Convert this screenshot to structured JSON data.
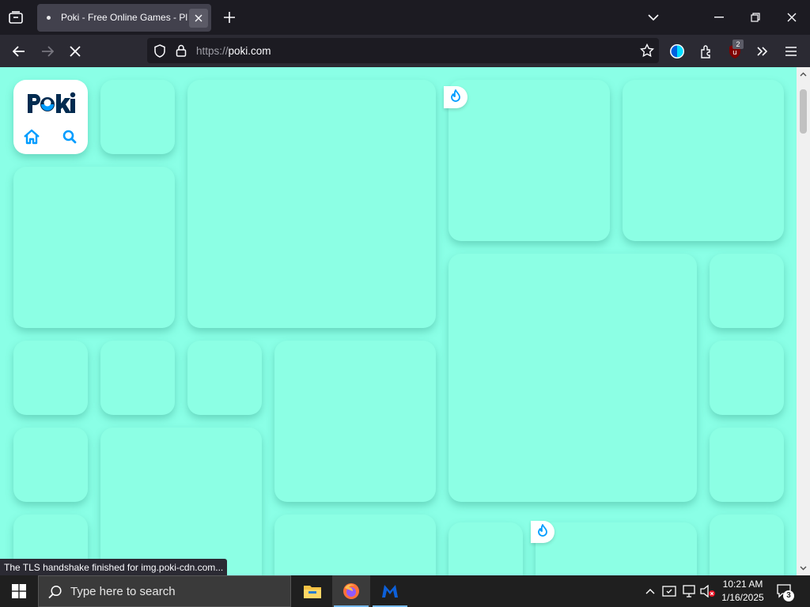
{
  "browser": {
    "tab": {
      "title": "Poki - Free Online Games - Play"
    },
    "url": {
      "scheme": "https://",
      "host": "poki.com"
    },
    "extensions_badge": "2",
    "status_text": "The TLS handshake finished for img.poki-cdn.com..."
  },
  "page": {
    "logo_text": "POKI",
    "icons": [
      "home-icon",
      "search-icon"
    ],
    "accent_color": "#009cff",
    "background_color": "#8affe6"
  },
  "taskbar": {
    "search_placeholder": "Type here to search",
    "time": "10:21 AM",
    "date": "1/16/2025",
    "notifications_count": "3",
    "apps": [
      "file-explorer",
      "firefox",
      "malwarebytes"
    ]
  }
}
